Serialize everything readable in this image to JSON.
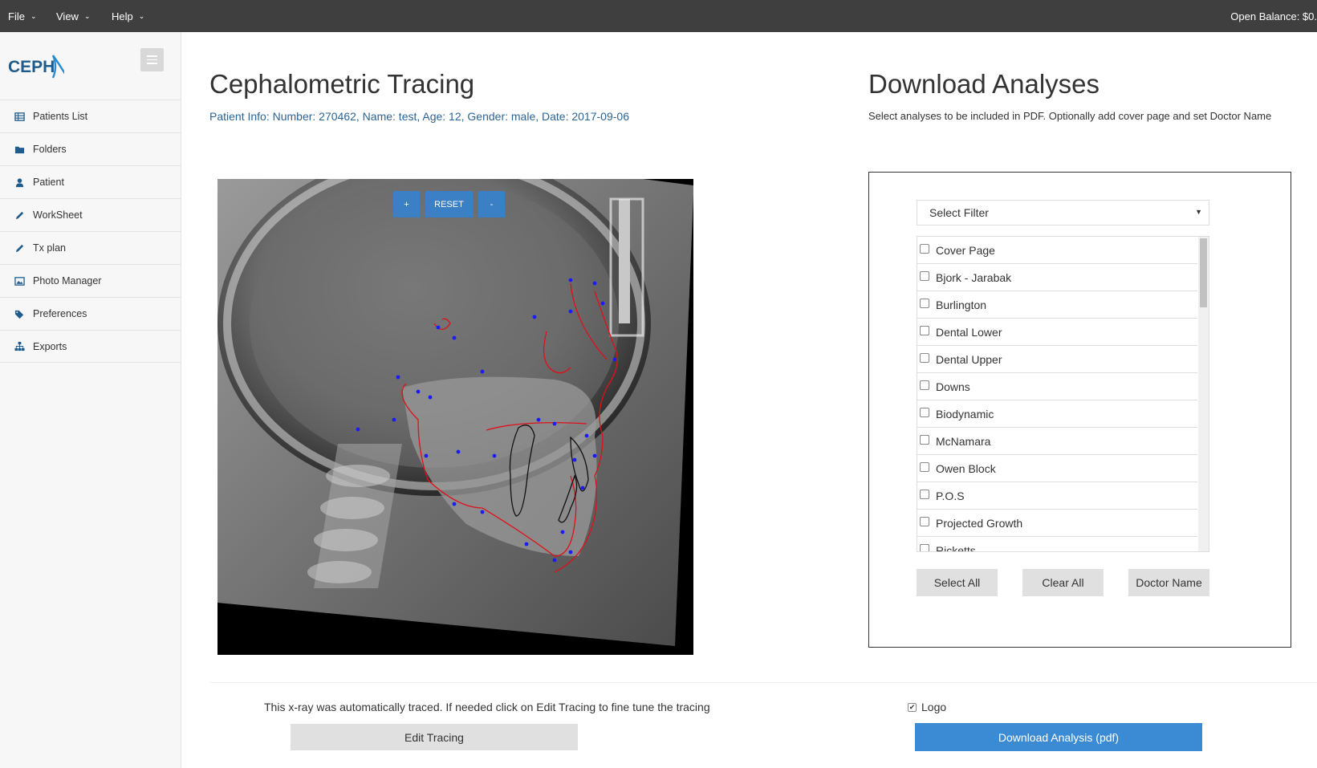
{
  "topbar": {
    "menus": [
      "File",
      "View",
      "Help"
    ],
    "balance": "Open Balance: $0."
  },
  "sidebar": {
    "logo_text": "CEPH",
    "items": [
      {
        "label": "Patients List",
        "icon": "table-icon"
      },
      {
        "label": "Folders",
        "icon": "folder-icon"
      },
      {
        "label": "Patient",
        "icon": "user-icon"
      },
      {
        "label": "WorkSheet",
        "icon": "pencil-icon"
      },
      {
        "label": "Tx plan",
        "icon": "pencil-icon"
      },
      {
        "label": "Photo Manager",
        "icon": "image-icon"
      },
      {
        "label": "Preferences",
        "icon": "tags-icon"
      },
      {
        "label": "Exports",
        "icon": "sitemap-icon"
      }
    ]
  },
  "tracing": {
    "title": "Cephalometric Tracing",
    "patient_info": "Patient Info: Number: 270462, Name: test, Age: 12, Gender: male, Date: 2017-09-06",
    "zoom_in": "+",
    "reset": "RESET",
    "zoom_out": "-",
    "note": "This x-ray was automatically traced. If needed click on Edit Tracing to fine tune the tracing",
    "edit_button": "Edit Tracing"
  },
  "analyses": {
    "title": "Download Analyses",
    "subtitle": "Select analyses to be included in PDF. Optionally add cover page and set Doctor Name",
    "filter_placeholder": "Select Filter",
    "items": [
      {
        "label": "Cover Page",
        "checked": false
      },
      {
        "label": "Bjork - Jarabak",
        "checked": false
      },
      {
        "label": "Burlington",
        "checked": false
      },
      {
        "label": "Dental Lower",
        "checked": false
      },
      {
        "label": "Dental Upper",
        "checked": false
      },
      {
        "label": "Downs",
        "checked": false
      },
      {
        "label": "Biodynamic",
        "checked": false
      },
      {
        "label": "McNamara",
        "checked": false
      },
      {
        "label": "Owen Block",
        "checked": false
      },
      {
        "label": "P.O.S",
        "checked": false
      },
      {
        "label": "Projected Growth",
        "checked": false
      },
      {
        "label": "Ricketts",
        "checked": false
      }
    ],
    "select_all": "Select All",
    "clear_all": "Clear All",
    "doctor_name": "Doctor Name",
    "logo_label": "Logo",
    "logo_checked": true,
    "download_button": "Download Analysis (pdf)"
  },
  "colors": {
    "accent": "#3b8bd4",
    "link": "#2a6496",
    "topbar": "#3f3f3f",
    "tracing_line": "#e0101a",
    "landmark": "#1a1aff"
  }
}
